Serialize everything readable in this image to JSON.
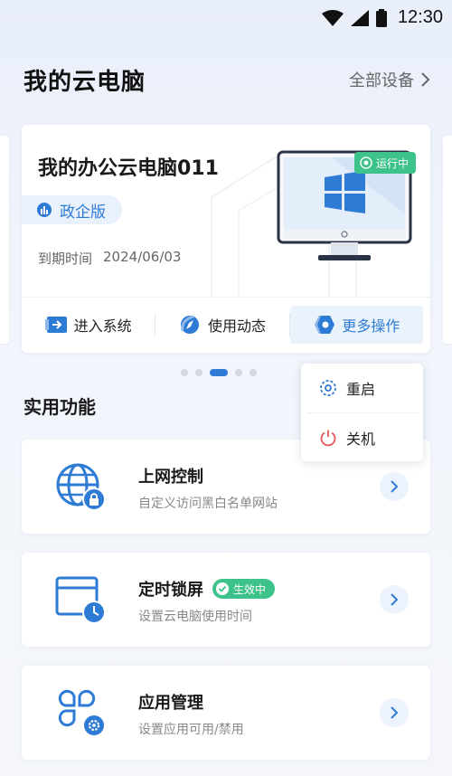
{
  "status_bar": {
    "time": "12:30"
  },
  "header": {
    "title": "我的云电脑",
    "all_devices_label": "全部设备"
  },
  "pc_card": {
    "name": "我的办公云电脑011",
    "edition": "政企版",
    "expire_label": "到期时间",
    "expire_date": "2024/06/03",
    "status_tag": "运行中",
    "actions": [
      {
        "label": "进入系统",
        "icon": "enter-system-icon"
      },
      {
        "label": "使用动态",
        "icon": "compass-icon"
      },
      {
        "label": "更多操作",
        "icon": "more-hexagon-icon"
      }
    ]
  },
  "carousel": {
    "page_count": 5,
    "active_index": 2
  },
  "more_menu": {
    "items": [
      {
        "label": "重启",
        "icon": "restart-icon"
      },
      {
        "label": "关机",
        "icon": "power-icon"
      }
    ]
  },
  "features_section": {
    "title": "实用功能",
    "items": [
      {
        "title": "上网控制",
        "subtitle": "自定义访问黑白名单网站",
        "icon": "globe-lock-icon",
        "badge": ""
      },
      {
        "title": "定时锁屏",
        "subtitle": "设置云电脑使用时间",
        "icon": "window-clock-icon",
        "badge": "生效中"
      },
      {
        "title": "应用管理",
        "subtitle": "设置应用可用/禁用",
        "icon": "apps-gear-icon",
        "badge": ""
      }
    ]
  },
  "colors": {
    "accent": "#2e7bd6",
    "success": "#3ec28b",
    "background": "#eef2f9"
  }
}
